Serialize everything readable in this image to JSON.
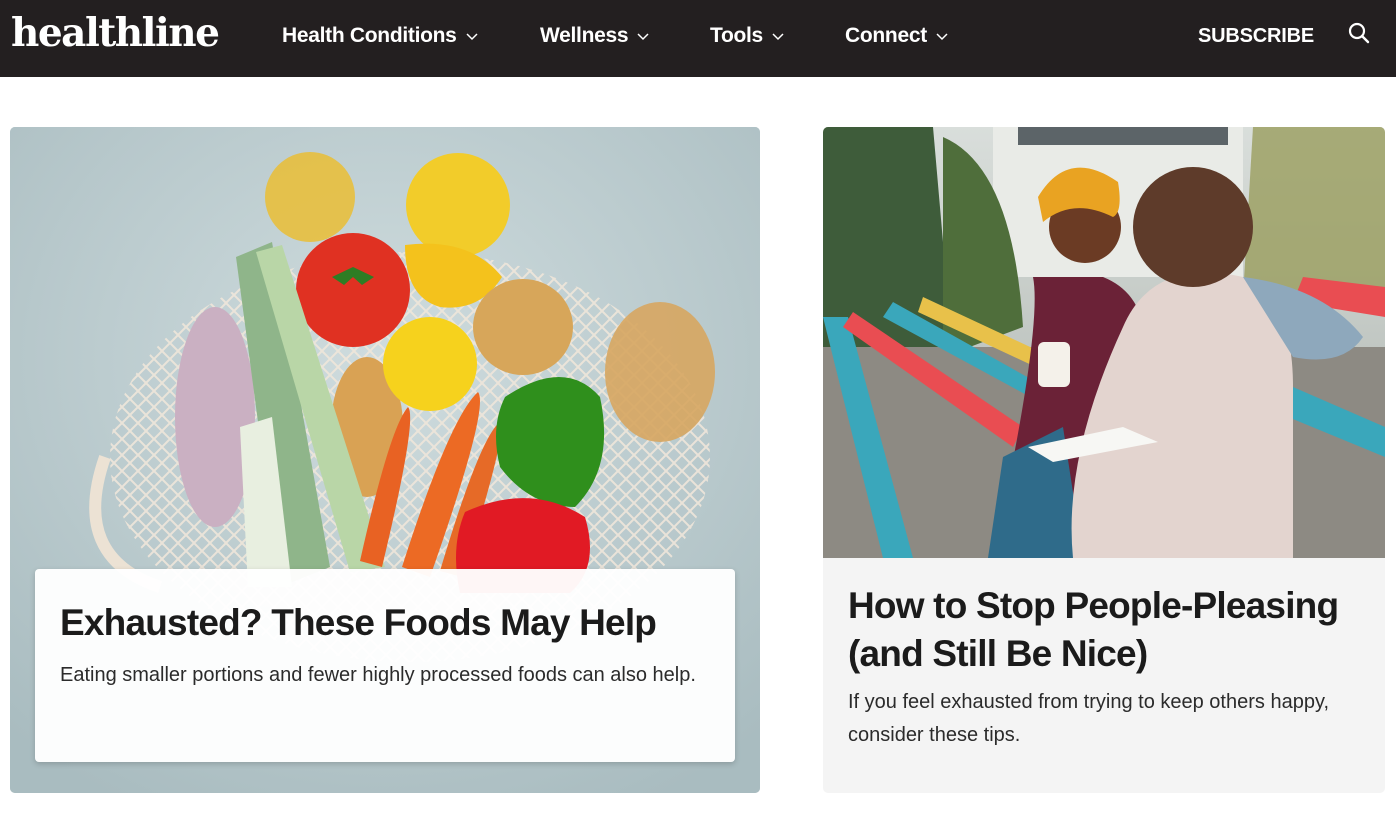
{
  "header": {
    "logo_text": "healthline",
    "nav": [
      {
        "label": "Health Conditions",
        "icon": "chevron-down-icon"
      },
      {
        "label": "Wellness",
        "icon": "chevron-down-icon"
      },
      {
        "label": "Tools",
        "icon": "chevron-down-icon"
      },
      {
        "label": "Connect",
        "icon": "chevron-down-icon"
      }
    ],
    "subscribe_label": "SUBSCRIBE",
    "search_icon": "search-icon"
  },
  "articles": [
    {
      "title": "Exhausted? These Foods May Help",
      "description": "Eating smaller portions and fewer highly processed foods can also help.",
      "image": "vegetables-in-mesh-bag"
    },
    {
      "title": "How to Stop People-Pleasing (and Still Be Nice)",
      "description": "If you feel exhausted from trying to keep others happy, consider these tips.",
      "image": "two-women-reading-on-bench"
    }
  ],
  "colors": {
    "header_bg": "#231f20",
    "header_text": "#ffffff",
    "card_bg": "#f4f4f4",
    "title_text": "#1b1b1b"
  }
}
